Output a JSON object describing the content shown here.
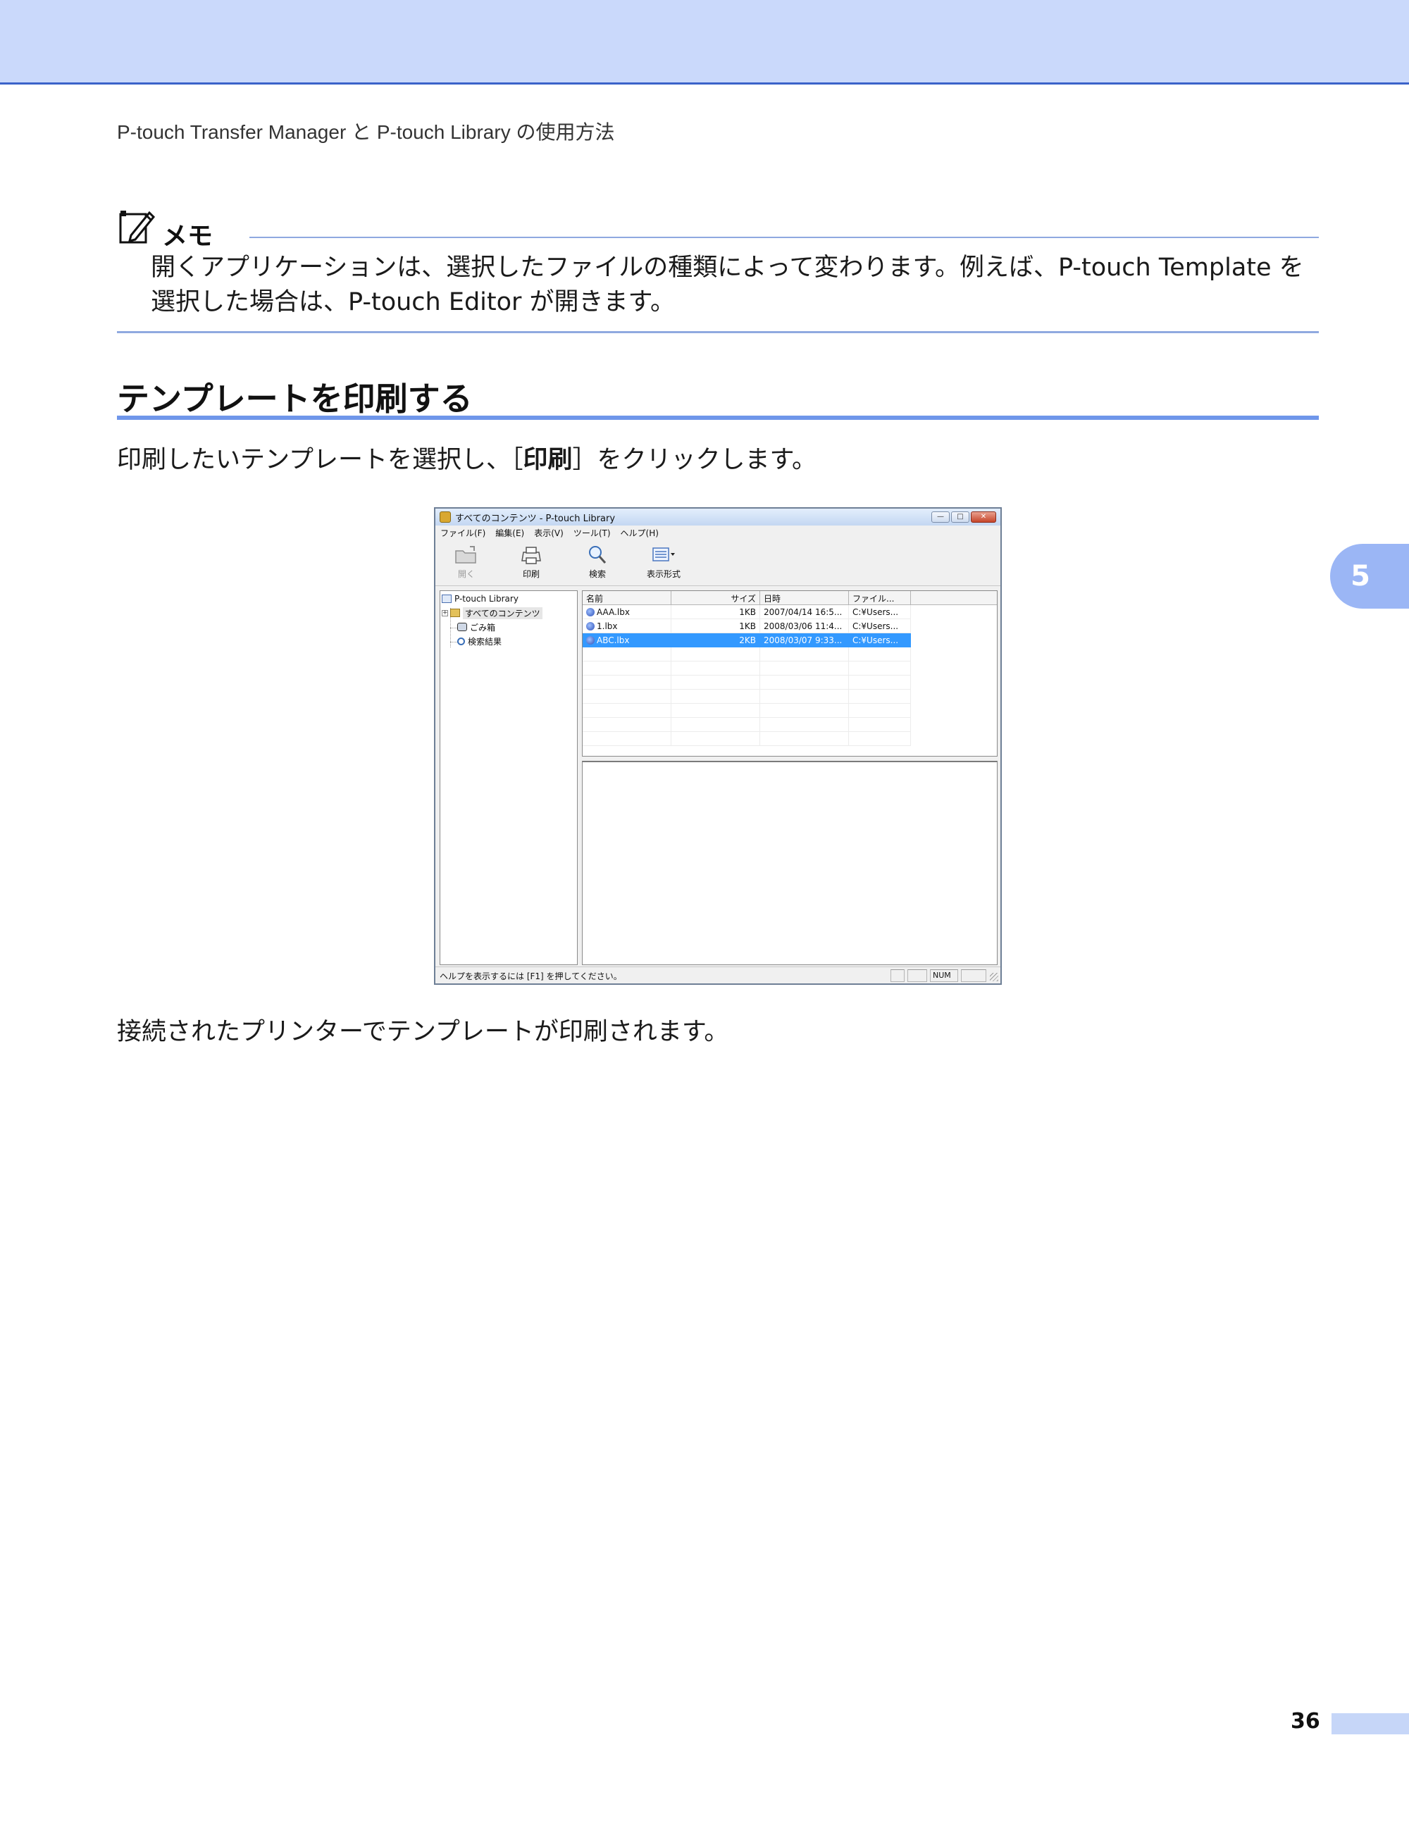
{
  "header": {
    "running_title": "P-touch Transfer Manager と P-touch Library の使用方法"
  },
  "memo": {
    "title": "メモ",
    "text": "開くアプリケーションは、選択したファイルの種類によって変わります。例えば、P-touch Template を選択した場合は、P-touch Editor が開きます。"
  },
  "section": {
    "title": "テンプレートを印刷する"
  },
  "body": {
    "instruction_before": "印刷したいテンプレートを選択し、［",
    "instruction_bold": "印刷",
    "instruction_after": "］をクリックします。",
    "result": "接続されたプリンターでテンプレートが印刷されます。"
  },
  "chapter_tab": "5",
  "page_number": "36",
  "window": {
    "title": "すべてのコンテンツ - P-touch Library",
    "controls": {
      "minimize": "—",
      "maximize": "□",
      "close": "✕"
    },
    "menu": [
      "ファイル(F)",
      "編集(E)",
      "表示(V)",
      "ツール(T)",
      "ヘルプ(H)"
    ],
    "toolbar": {
      "open": "開く",
      "print": "印刷",
      "search": "検索",
      "view": "表示形式"
    },
    "tree": {
      "root": "P-touch Library",
      "all_contents": "すべてのコンテンツ",
      "trash": "ごみ箱",
      "search_results": "検索結果"
    },
    "list": {
      "columns": [
        "名前",
        "サイズ",
        "日時",
        "ファイル..."
      ],
      "rows": [
        {
          "name": "AAA.lbx",
          "size": "1KB",
          "date": "2007/04/14 16:5...",
          "file": "C:¥Users..."
        },
        {
          "name": "1.lbx",
          "size": "1KB",
          "date": "2008/03/06 11:4...",
          "file": "C:¥Users..."
        },
        {
          "name": "ABC.lbx",
          "size": "2KB",
          "date": "2008/03/07 9:33...",
          "file": "C:¥Users..."
        }
      ],
      "selected_index": 2
    },
    "status": {
      "help": "ヘルプを表示するには [F1] を押してください。",
      "num": "NUM"
    }
  }
}
